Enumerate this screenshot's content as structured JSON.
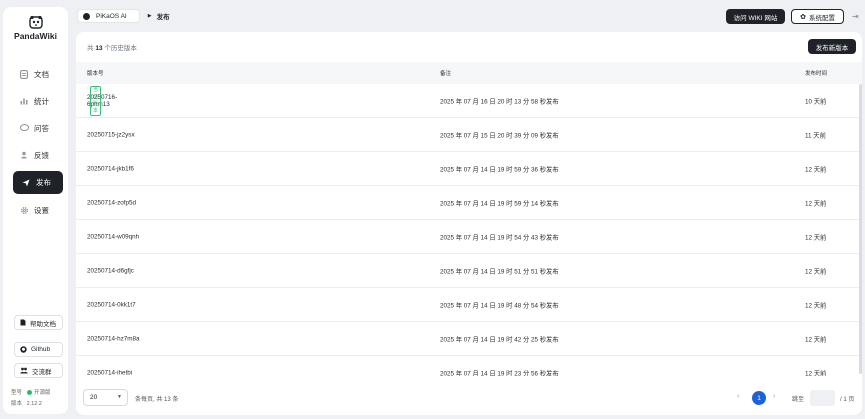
{
  "app": {
    "name": "PandaWiki"
  },
  "sidebar": {
    "items": [
      {
        "label": "文档",
        "icon": "document-icon"
      },
      {
        "label": "统计",
        "icon": "chart-icon"
      },
      {
        "label": "问答",
        "icon": "chat-icon"
      },
      {
        "label": "反馈",
        "icon": "feedback-icon"
      },
      {
        "label": "发布",
        "icon": "send-icon",
        "active": true
      },
      {
        "label": "设置",
        "icon": "gear-icon"
      }
    ],
    "help_doc": "帮助文档",
    "github": "Github",
    "community": "交流群",
    "version_type_label": "型号",
    "version_type": "开源版",
    "version_label": "版本",
    "version": "2.12.2"
  },
  "header": {
    "kb_name": "PiKaOS AI",
    "current_page": "发布",
    "visit_site": "访问 WIKI 网站",
    "settings": "系统配置"
  },
  "main": {
    "count_prefix": "共",
    "count": "13",
    "count_suffix": "个历史版本",
    "publish_button": "发布新版本",
    "columns": {
      "version": "版本号",
      "remark": "备注",
      "time": "发布时间"
    },
    "current_badge": "当前版本",
    "rows": [
      {
        "version": "20250716-6pnm13",
        "remark": "2025 年 07 月 16 日 20 时 13 分 58 秒发布",
        "time": "10 天前",
        "current": true
      },
      {
        "version": "20250715-jz2ysx",
        "remark": "2025 年 07 月 15 日 20 时 39 分 09 秒发布",
        "time": "11 天前"
      },
      {
        "version": "20250714-jkb1f6",
        "remark": "2025 年 07 月 14 日 19 时 59 分 36 秒发布",
        "time": "12 天前"
      },
      {
        "version": "20250714-zofp5d",
        "remark": "2025 年 07 月 14 日 19 时 59 分 14 秒发布",
        "time": "12 天前"
      },
      {
        "version": "20250714-w09qnh",
        "remark": "2025 年 07 月 14 日 19 时 54 分 43 秒发布",
        "time": "12 天前"
      },
      {
        "version": "20250714-d6gfjc",
        "remark": "2025 年 07 月 14 日 19 时 51 分 51 秒发布",
        "time": "12 天前"
      },
      {
        "version": "20250714-0kk1t7",
        "remark": "2025 年 07 月 14 日 19 时 48 分 54 秒发布",
        "time": "12 天前"
      },
      {
        "version": "20250714-hz7m8a",
        "remark": "2025 年 07 月 14 日 19 时 42 分 25 秒发布",
        "time": "12 天前"
      },
      {
        "version": "20250714-ihetbi",
        "remark": "2025 年 07 月 14 日 19 时 23 分 56 秒发布",
        "time": "12 天前"
      }
    ]
  },
  "pagination": {
    "page_size": "20",
    "info": "条每页, 共 13 条",
    "current_page": "1",
    "jump_label": "跳至",
    "total_pages": "/ 1 页"
  },
  "colors": {
    "accent": "#1e63d6",
    "dark": "#1f2329",
    "badge": "#3ac07a"
  }
}
